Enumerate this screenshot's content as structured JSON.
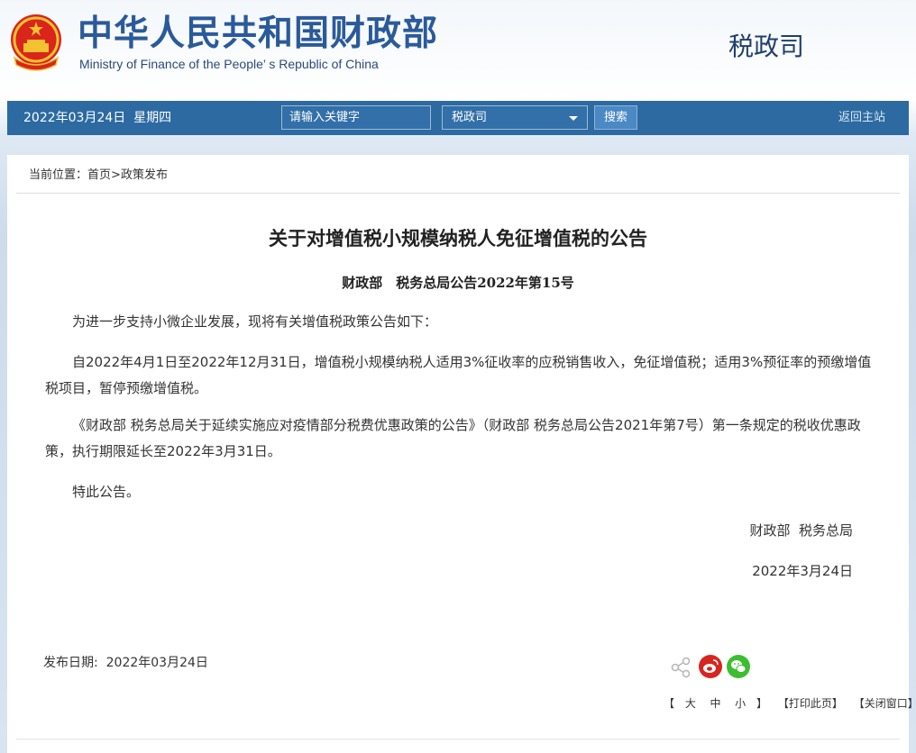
{
  "header": {
    "ministry_cn": "中华人民共和国财政部",
    "ministry_en": "Ministry of Finance of the People’ s Republic of China",
    "department": "税政司",
    "emblem_icon": "national-emblem-icon"
  },
  "nav": {
    "date": "2022年03月24日  星期四",
    "search_placeholder": "请输入关键字",
    "select_value": "税政司",
    "search_button": "搜索",
    "home_link": "返回主站"
  },
  "breadcrumb": {
    "prefix": "当前位置：",
    "home": "首页",
    "sep": ">",
    "section": "政策发布"
  },
  "article": {
    "title": "关于对增值税小规模纳税人免征增值税的公告",
    "subtitle": "财政部　税务总局公告2022年第15号",
    "paragraphs": [
      "为进一步支持小微企业发展，现将有关增值税政策公告如下：",
      "自2022年4月1日至2022年12月31日，增值税小规模纳税人适用3%征收率的应税销售收入，免征增值税；适用3%预征率的预缴增值税项目，暂停预缴增值税。",
      "《财政部 税务总局关于延续实施应对疫情部分税费优惠政策的公告》（财政部 税务总局公告2021年第7号）第一条规定的税收优惠政策，执行期限延长至2022年3月31日。",
      "特此公告。"
    ],
    "signature_org": "财政部  税务总局",
    "signature_date": "2022年3月24日"
  },
  "footer": {
    "publish_label": "发布日期:",
    "publish_date": "2022年03月24日",
    "font_bracket_open": "【",
    "font_large": "大",
    "font_medium": "中",
    "font_small": "小",
    "font_bracket_close": "】",
    "print": "【打印此页】",
    "close": "【关闭窗口】"
  },
  "colors": {
    "nav_bg": "#2c6aa1",
    "title_blue": "#2a5a9a",
    "weibo_red": "#d7241f",
    "wechat_green": "#3ebd33"
  }
}
